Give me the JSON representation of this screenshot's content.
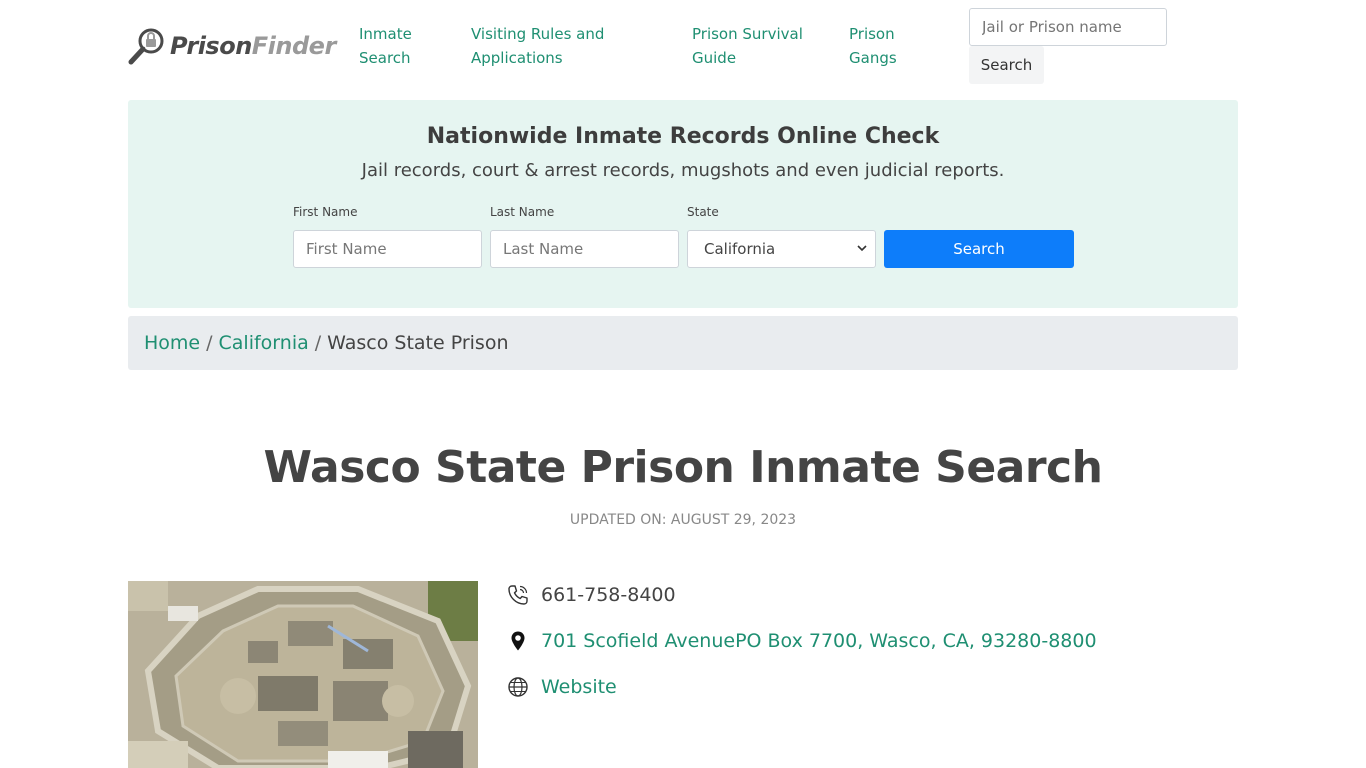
{
  "header": {
    "logo_prison": "Prison",
    "logo_finder": "Finder",
    "nav": [
      {
        "line1": "Inmate",
        "line2": "Search"
      },
      {
        "line1": "Visiting Rules and",
        "line2": "Applications"
      },
      {
        "line1": "Prison Survival",
        "line2": "Guide"
      },
      {
        "line1": "Prison",
        "line2": "Gangs"
      }
    ],
    "search_placeholder": "Jail or Prison name",
    "search_button": "Search"
  },
  "records": {
    "title": "Nationwide Inmate Records Online Check",
    "subtitle": "Jail records, court & arrest records, mugshots and even judicial reports.",
    "first_name_label": "First Name",
    "first_name_placeholder": "First Name",
    "last_name_label": "Last Name",
    "last_name_placeholder": "Last Name",
    "state_label": "State",
    "state_value": "California",
    "search_button": "Search"
  },
  "breadcrumb": {
    "home": "Home",
    "sep": "/",
    "state": "California",
    "current": "Wasco State Prison"
  },
  "page": {
    "title": "Wasco State Prison Inmate Search",
    "updated": "UPDATED ON: AUGUST 29, 2023"
  },
  "contact": {
    "phone": "661-758-8400",
    "address": "701 Scofield AvenuePO Box 7700, Wasco, CA, 93280-8800",
    "website": "Website"
  },
  "icons": {
    "logo": "magnifier-lock-icon",
    "phone": "phone-icon",
    "address": "map-pin-icon",
    "website": "globe-icon"
  },
  "colors": {
    "link": "#1f8f72",
    "primary_button": "#0d7dfa",
    "records_bg": "#e6f5f1",
    "breadcrumb_bg": "#e9ecef"
  }
}
